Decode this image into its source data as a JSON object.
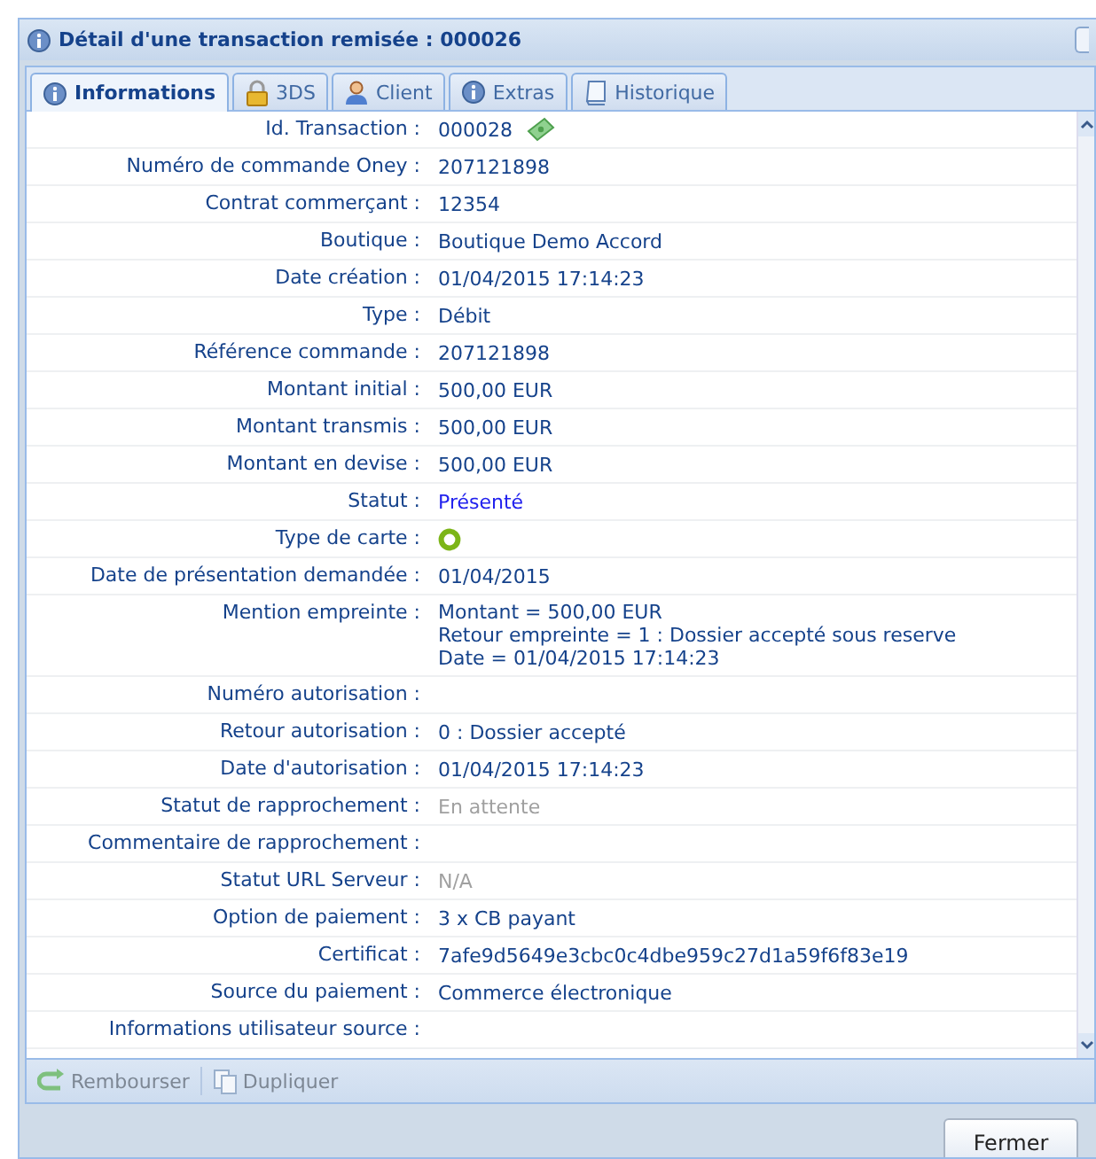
{
  "window": {
    "title": "Détail d'une transaction remisée : 000026"
  },
  "tabs": [
    {
      "label": "Informations",
      "selected": true
    },
    {
      "label": "3DS",
      "selected": false
    },
    {
      "label": "Client",
      "selected": false
    },
    {
      "label": "Extras",
      "selected": false
    },
    {
      "label": "Historique",
      "selected": false
    }
  ],
  "rows": [
    {
      "label": "Id. Transaction :",
      "kind": "id",
      "value": "000028"
    },
    {
      "label": "Numéro de commande Oney :",
      "kind": "text",
      "value": "207121898"
    },
    {
      "label": "Contrat commerçant :",
      "kind": "text",
      "value": "12354"
    },
    {
      "label": "Boutique :",
      "kind": "text",
      "value": "Boutique Demo Accord"
    },
    {
      "label": "Date création :",
      "kind": "text",
      "value": "01/04/2015 17:14:23"
    },
    {
      "label": "Type :",
      "kind": "text",
      "value": "Débit"
    },
    {
      "label": "Référence commande :",
      "kind": "text",
      "value": "207121898"
    },
    {
      "label": "Montant initial :",
      "kind": "text",
      "value": "500,00 EUR"
    },
    {
      "label": "Montant transmis :",
      "kind": "text",
      "value": "500,00 EUR"
    },
    {
      "label": "Montant en devise :",
      "kind": "text",
      "value": "500,00 EUR"
    },
    {
      "label": "Statut :",
      "kind": "accent",
      "value": "Présenté"
    },
    {
      "label": "Type de carte :",
      "kind": "icon"
    },
    {
      "label": "Date de présentation demandée :",
      "kind": "text",
      "value": "01/04/2015"
    },
    {
      "label": "Mention empreinte :",
      "kind": "lines",
      "lines": [
        "Montant = 500,00 EUR",
        "Retour empreinte = 1 : Dossier accepté sous reserve",
        "Date = 01/04/2015 17:14:23"
      ]
    },
    {
      "label": "Numéro autorisation :",
      "kind": "empty"
    },
    {
      "label": "Retour autorisation :",
      "kind": "text",
      "value": "0 : Dossier accepté"
    },
    {
      "label": "Date d'autorisation :",
      "kind": "text",
      "value": "01/04/2015 17:14:23"
    },
    {
      "label": "Statut de rapprochement :",
      "kind": "muted",
      "value": "En attente"
    },
    {
      "label": "Commentaire de rapprochement :",
      "kind": "empty"
    },
    {
      "label": "Statut URL Serveur :",
      "kind": "muted",
      "value": "N/A"
    },
    {
      "label": "Option de paiement :",
      "kind": "text",
      "value": "3 x CB payant"
    },
    {
      "label": "Certificat :",
      "kind": "text",
      "value": "7afe9d5649e3cbc0c4dbe959c27d1a59f6f83e19"
    },
    {
      "label": "Source du paiement :",
      "kind": "text",
      "value": "Commerce électronique"
    },
    {
      "label": "Informations utilisateur source :",
      "kind": "empty"
    }
  ],
  "toolbar": [
    {
      "label": "Rembourser",
      "disabled": true
    },
    {
      "label": "Dupliquer",
      "disabled": true
    }
  ],
  "close_button": "Fermer"
}
